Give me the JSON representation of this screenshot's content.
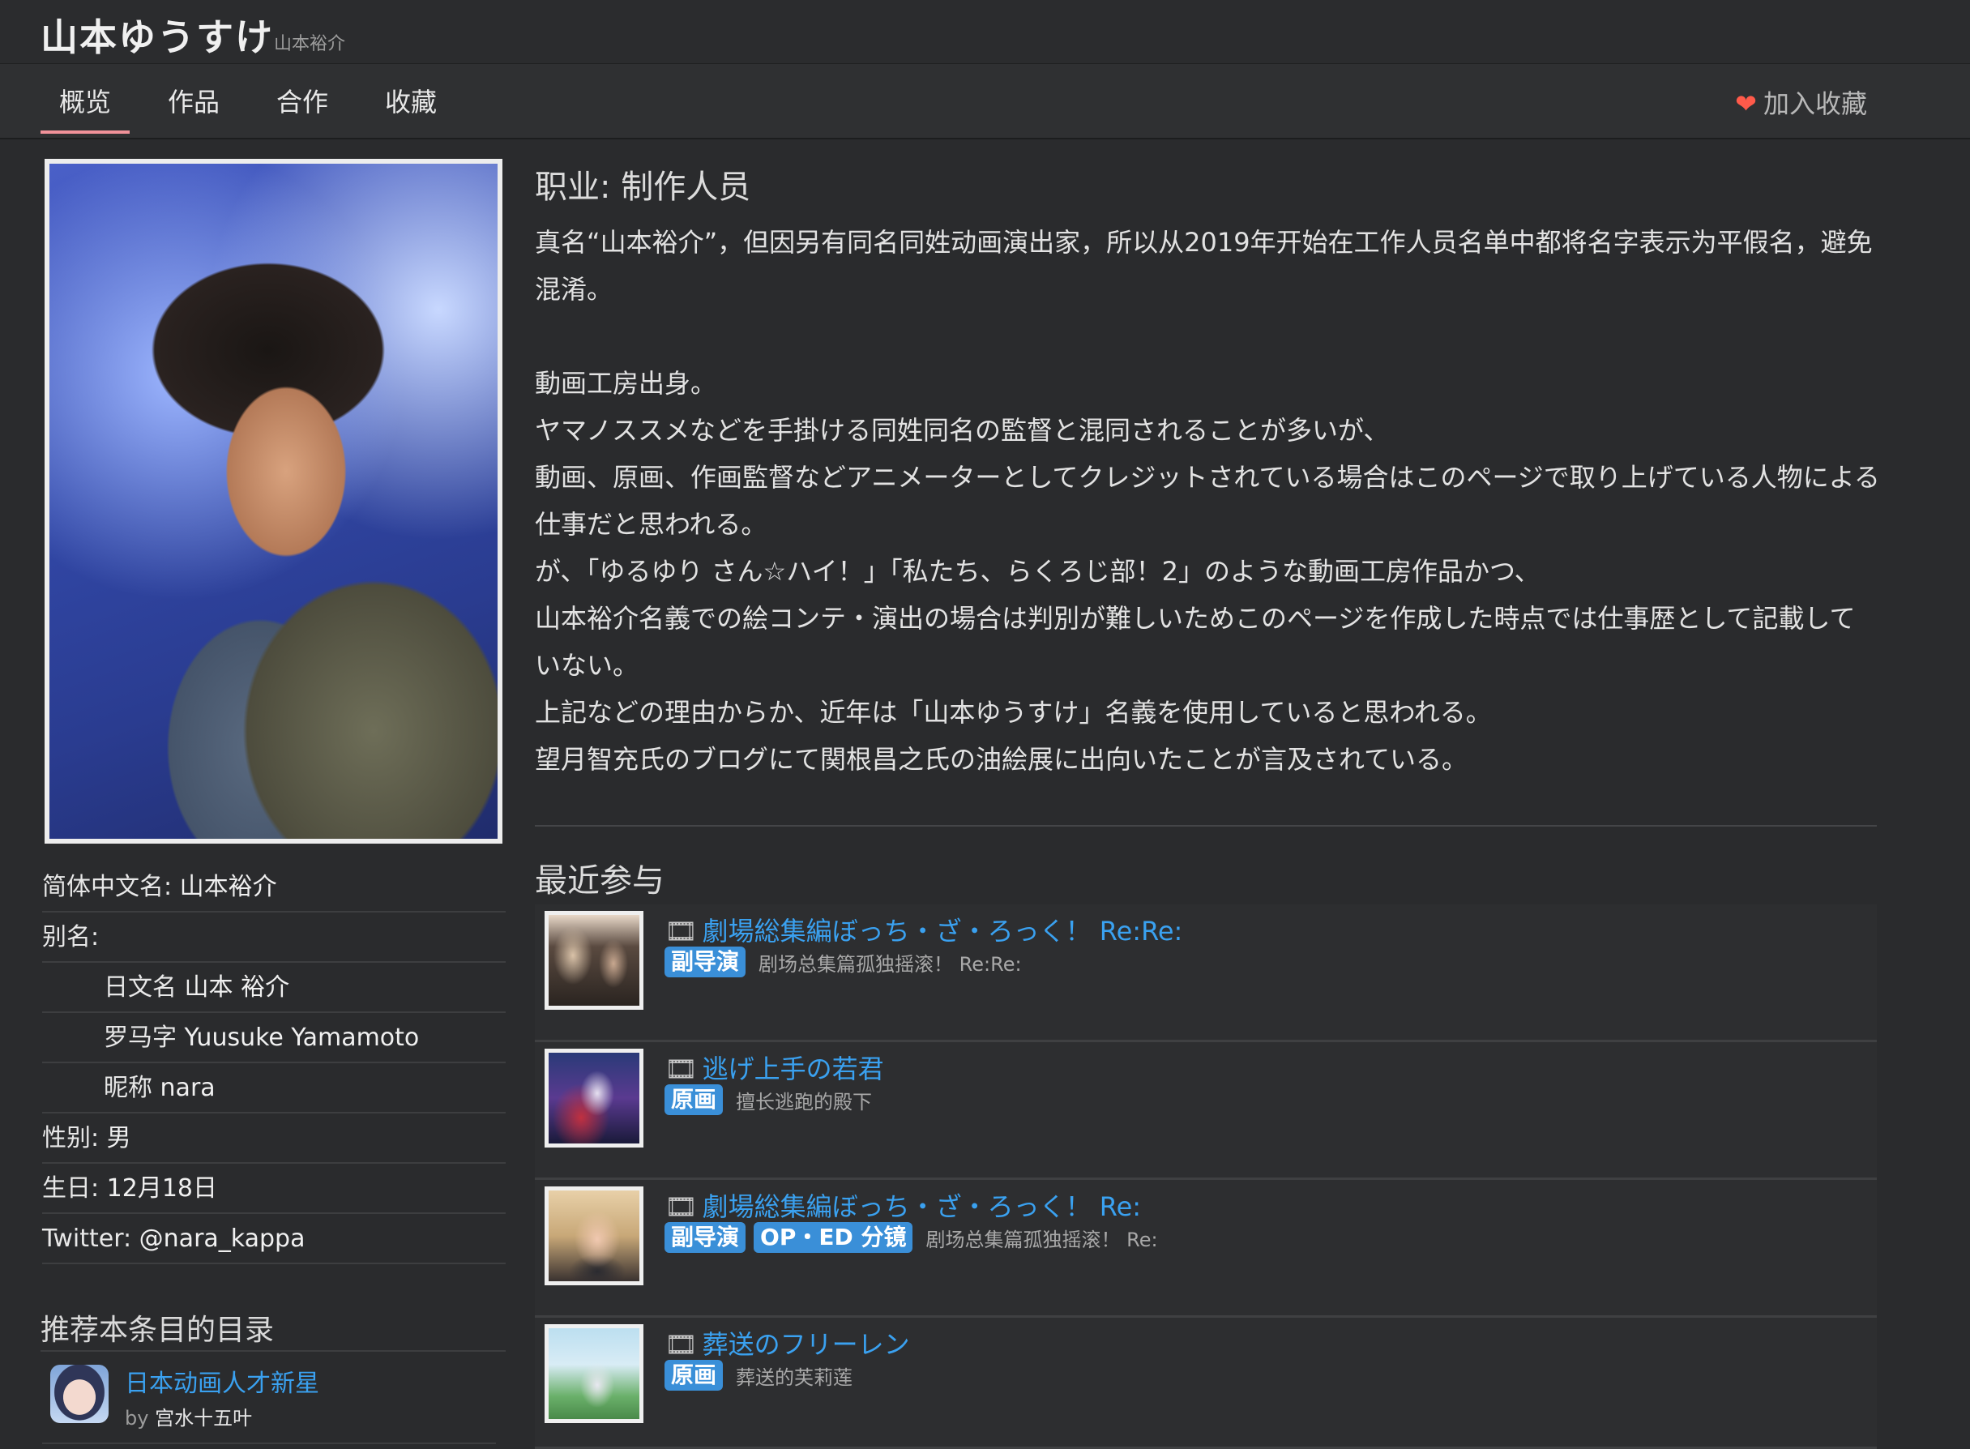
{
  "header": {
    "name": "山本ゆうすけ",
    "subname": "山本裕介"
  },
  "nav": {
    "tabs": [
      {
        "label": "概览",
        "active": true
      },
      {
        "label": "作品",
        "active": false
      },
      {
        "label": "合作",
        "active": false
      },
      {
        "label": "收藏",
        "active": false
      }
    ],
    "favorite_label": "加入收藏",
    "favorite_icon": "heart-icon"
  },
  "profile": {
    "rows": [
      {
        "key": "简体中文名: ",
        "value": "山本裕介",
        "indent": false
      },
      {
        "key": "别名:",
        "value": "",
        "indent": false
      },
      {
        "key": "日文名 ",
        "value": "山本 裕介",
        "indent": true
      },
      {
        "key": "罗马字 ",
        "value": "Yuusuke Yamamoto",
        "indent": true
      },
      {
        "key": "昵称 ",
        "value": "nara",
        "indent": true
      },
      {
        "key": "性别: ",
        "value": "男",
        "indent": false
      },
      {
        "key": "生日: ",
        "value": "12月18日",
        "indent": false
      },
      {
        "key": "Twitter: ",
        "value": "@nara_kappa",
        "indent": false
      }
    ]
  },
  "recommend": {
    "title": "推荐本条目的目录",
    "item": {
      "name": "日本动画人才新星",
      "by_prefix": "by ",
      "by_user": "宫水十五叶"
    }
  },
  "main": {
    "job": "职业: 制作人员",
    "bio": [
      "真名“山本裕介”，但因另有同名同姓动画演出家，所以从2019年开始在工作人员名单中都将名字表示为平假名，避免混淆。",
      "",
      "動画工房出身。",
      "ヤマノススメなどを手掛ける同姓同名の監督と混同されることが多いが、",
      "動画、原画、作画監督などアニメーターとしてクレジットされている場合はこのページで取り上げている人物による仕事だと思われる。",
      "が、「ゆるゆり さん☆ハイ！」「私たち、らくろじ部！2」のような動画工房作品かつ、",
      "山本裕介名義での絵コンテ・演出の場合は判別が難しいためこのページを作成した時点では仕事歴として記載していない。",
      "上記などの理由からか、近年は「山本ゆうすけ」名義を使用していると思われる。",
      "望月智充氏のブログにて関根昌之氏の油絵展に出向いたことが言及されている。"
    ],
    "recent_title": "最近参与",
    "works": [
      {
        "icon": "film-icon",
        "title": "劇場総集編ぼっち・ざ・ろっく！ Re:Re:",
        "roles": [
          "副导演"
        ],
        "cn": "剧场总集篇孤独摇滚！ Re:Re:"
      },
      {
        "icon": "film-icon",
        "title": "逃げ上手の若君",
        "roles": [
          "原画"
        ],
        "cn": "擅长逃跑的殿下"
      },
      {
        "icon": "film-icon",
        "title": "劇場総集編ぼっち・ざ・ろっく！ Re:",
        "roles": [
          "副导演",
          "OP・ED 分镜"
        ],
        "cn": "剧场总集篇孤独摇滚！ Re:"
      },
      {
        "icon": "film-icon",
        "title": "葬送のフリーレン",
        "roles": [
          "原画"
        ],
        "cn": "葬送的芙莉莲"
      }
    ]
  },
  "colors": {
    "link": "#3aa1f0",
    "badge": "#3a8fd8",
    "active_tab": "#f09199",
    "heart": "#ff5a4a"
  }
}
